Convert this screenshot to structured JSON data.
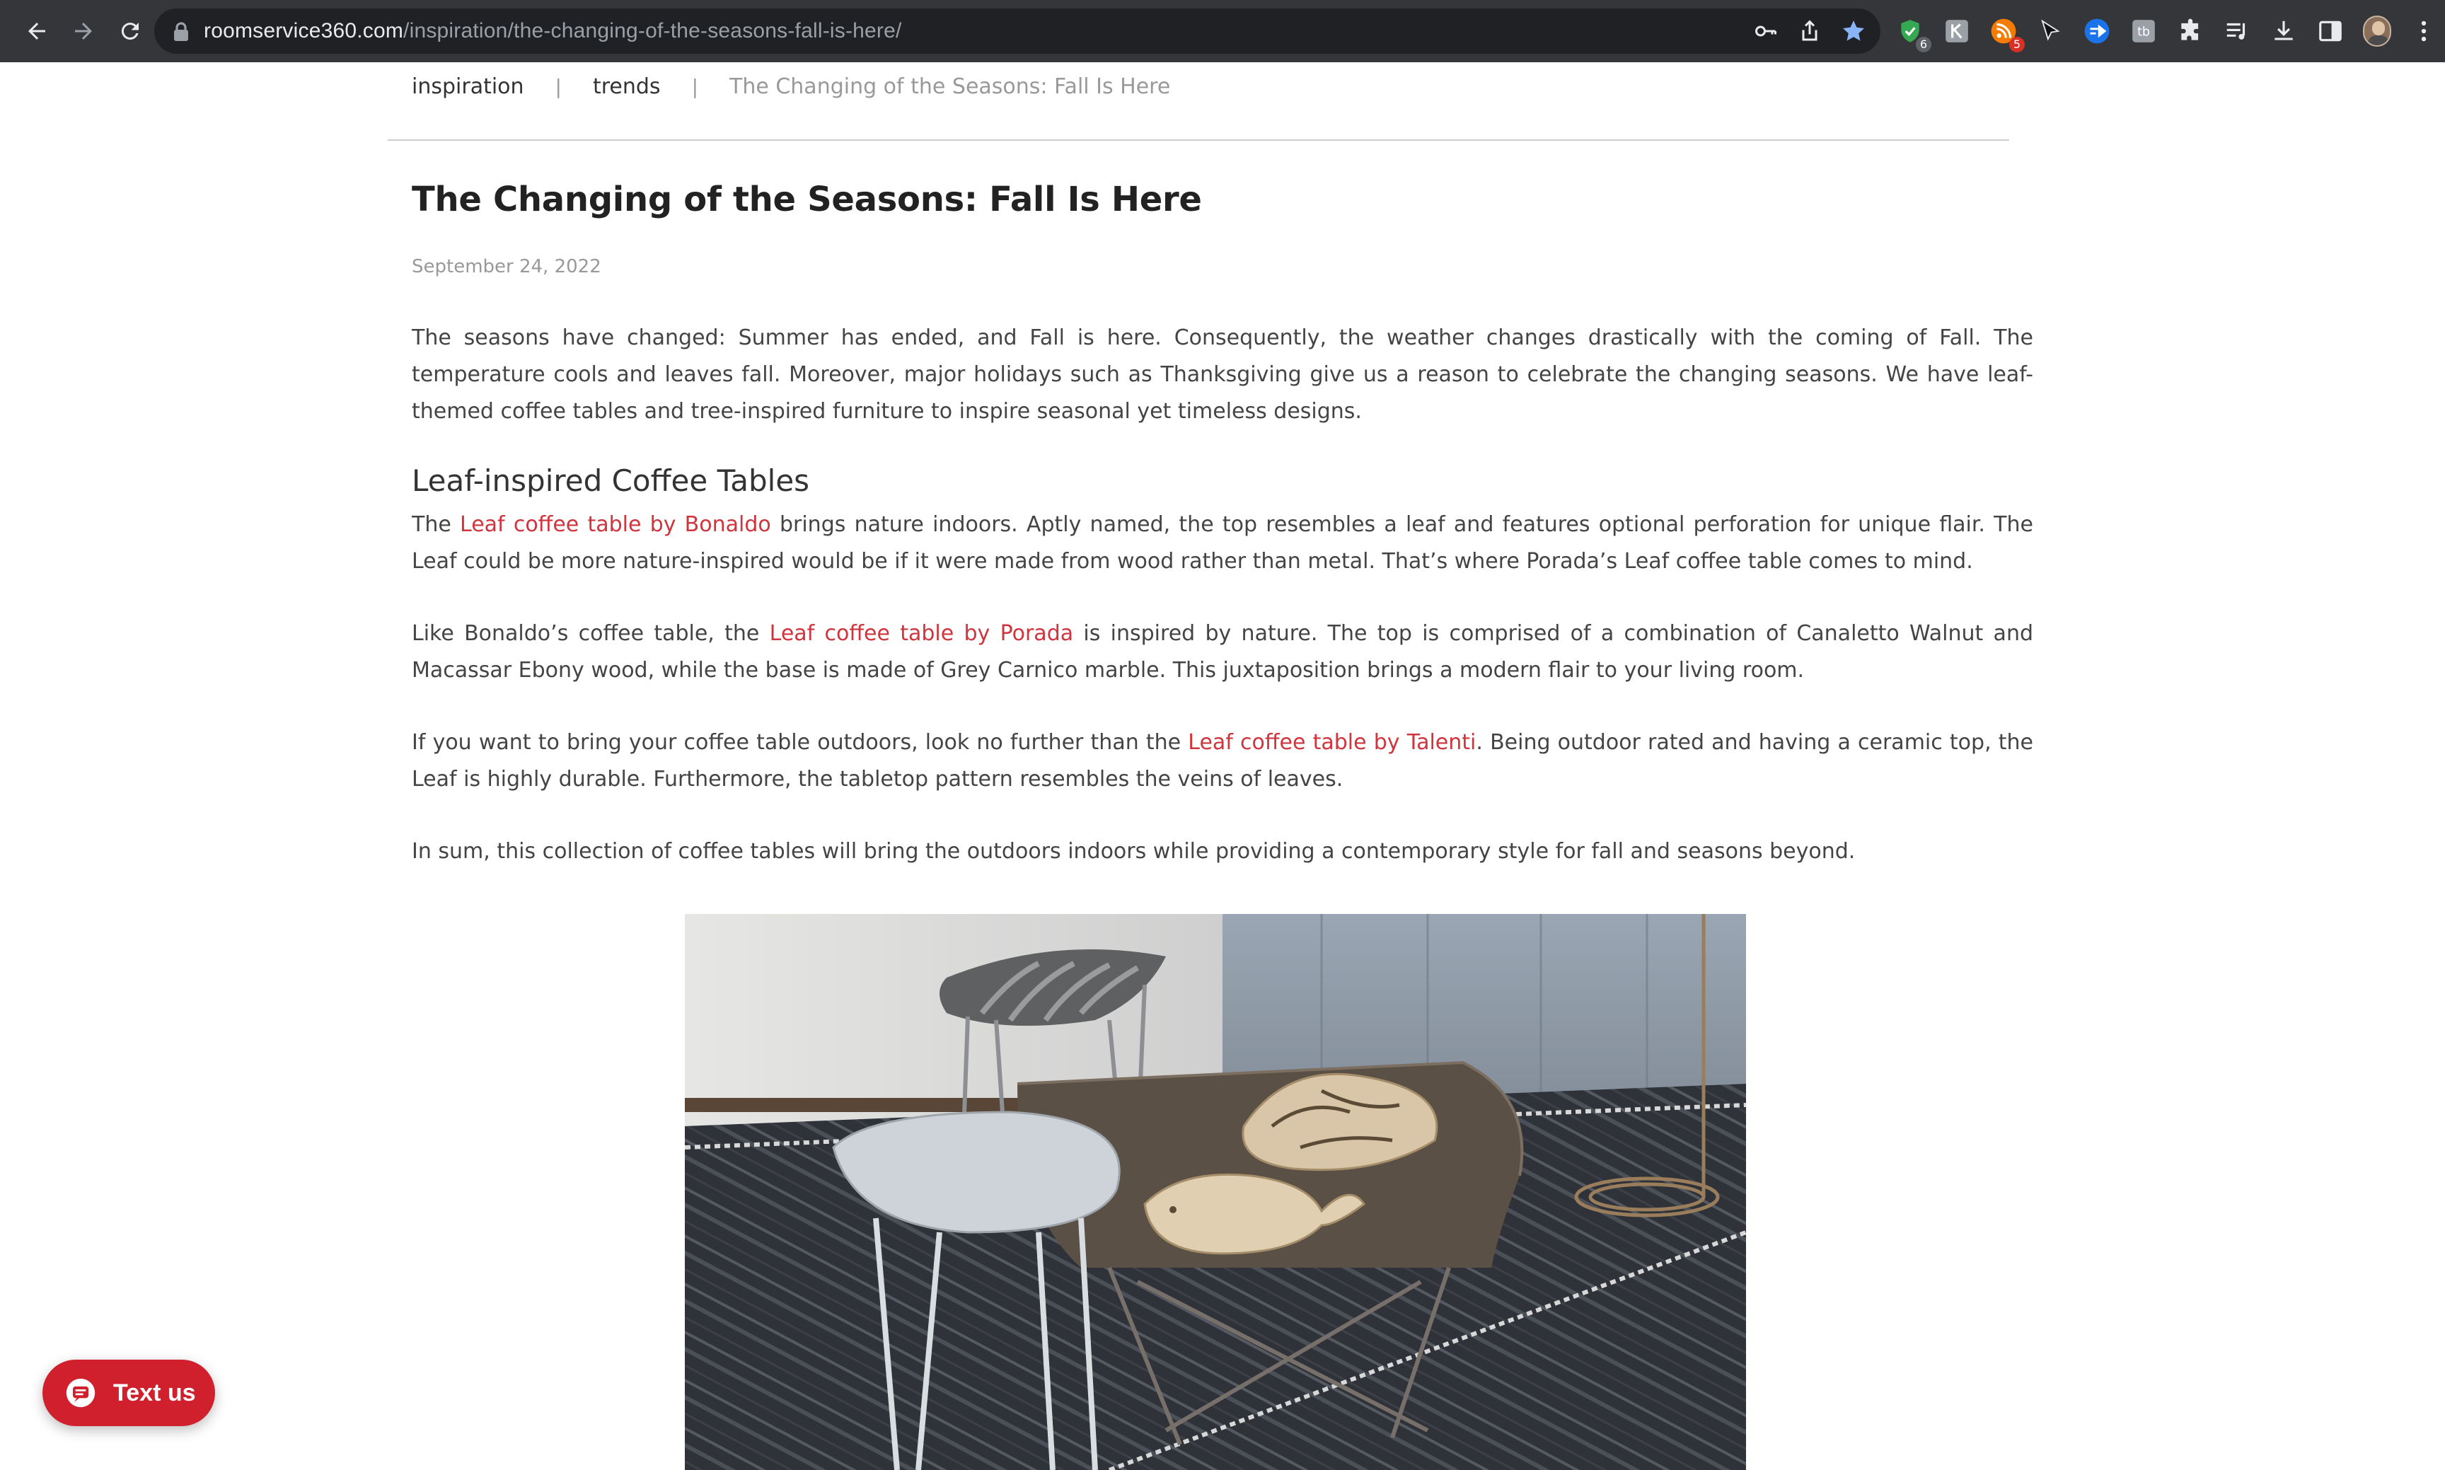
{
  "browser": {
    "url_host": "roomservice360.com",
    "url_path": "/inspiration/the-changing-of-the-seasons-fall-is-here/",
    "extensions": [
      {
        "name": "shield-check-extension-icon",
        "badge": "6",
        "badge_color": "#5f6368"
      },
      {
        "name": "k-extension-icon",
        "badge": "",
        "badge_color": ""
      },
      {
        "name": "rss-extension-icon",
        "badge": "5",
        "badge_color": "#d93025"
      },
      {
        "name": "cursor-extension-icon",
        "badge": "",
        "badge_color": ""
      },
      {
        "name": "play-extension-icon",
        "badge": "",
        "badge_color": ""
      },
      {
        "name": "tb-extension-icon",
        "badge": "",
        "badge_color": ""
      }
    ]
  },
  "breadcrumb": {
    "items": [
      "inspiration",
      "trends"
    ],
    "separator": "|",
    "current": "The Changing of the Seasons: Fall Is Here"
  },
  "article": {
    "title": "The Changing of the Seasons: Fall Is Here",
    "date": "September 24, 2022",
    "intro": "The seasons have changed: Summer has ended, and Fall is here. Consequently, the weather changes drastically with the coming of Fall. The temperature cools and leaves fall. Moreover, major holidays such as Thanksgiving give us a reason to celebrate the changing seasons. We have leaf-themed coffee tables and tree-inspired furniture to inspire seasonal yet timeless designs.",
    "section_heading": "Leaf-inspired Coffee Tables",
    "p1": {
      "before": "The ",
      "link": "Leaf coffee table by Bonaldo",
      "after": " brings nature indoors. Aptly named, the top resembles a leaf and features optional perforation for unique flair. The Leaf could be more nature-inspired would be if it were made from wood rather than metal. That’s where Porada’s Leaf coffee table comes to mind."
    },
    "p2": {
      "before": "Like Bonaldo’s coffee table, the ",
      "link": "Leaf coffee table by Porada",
      "after": " is inspired by nature. The top is comprised of a combination of Canaletto Walnut and Macassar Ebony wood, while the base is made of Grey Carnico marble. This juxtaposition brings a modern flair to your living room."
    },
    "p3": {
      "before": "If you want to bring your coffee table outdoors, look no further than the ",
      "link": "Leaf coffee table by Talenti",
      "after": ". Being outdoor rated and having a ceramic top, the Leaf is highly durable. Furthermore, the tabletop pattern resembles the veins of leaves."
    },
    "p4": "In sum, this collection of coffee tables will bring the outdoors indoors while providing a contemporary style for fall and seasons beyond."
  },
  "widget": {
    "text_us_label": "Text us"
  },
  "colors": {
    "link": "#d0343c",
    "widget_bg": "#d0202e",
    "chrome_bg": "#35363a",
    "omnibox_bg": "#202124"
  }
}
